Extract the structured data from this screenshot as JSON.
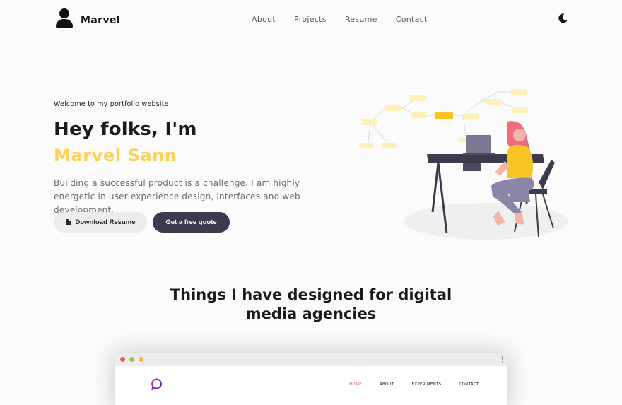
{
  "nav": {
    "brand": "Marvel",
    "brand_icon": "user-icon",
    "links": [
      "About",
      "Projects",
      "Resume",
      "Contact"
    ],
    "theme_icon": "moon-icon"
  },
  "hero": {
    "welcome": "Welcome to my portfolio website!",
    "title": "Hey folks, I'm",
    "name": "Marvel Sann",
    "description": "Building a successful product is a challenge. I am highly energetic in user experience design, interfaces and web development.",
    "download_button": "Download Resume",
    "download_icon": "document-icon",
    "quote_button": "Get a free quote"
  },
  "section": {
    "title": "Things I have designed for digital media agencies"
  },
  "mockup": {
    "nav": [
      "HOME",
      "ABOUT",
      "EXPERIMENTS",
      "CONTACT"
    ],
    "active": "HOME"
  },
  "colors": {
    "accent": "#fdd152",
    "button_dark": "#3c3a4c",
    "button_light": "#ececec",
    "mockup_active": "#e4566a"
  }
}
